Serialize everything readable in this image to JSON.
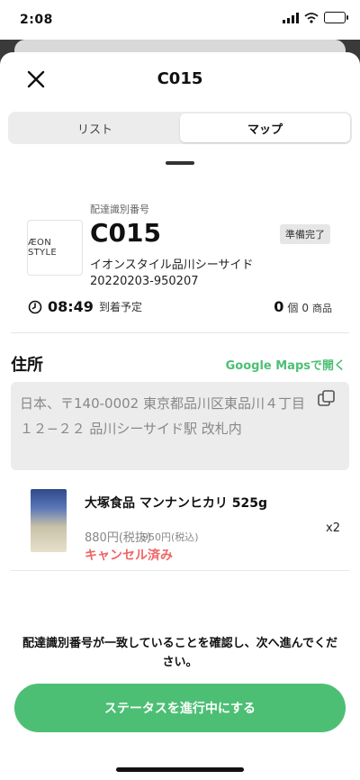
{
  "status_bar": {
    "time": "2:08"
  },
  "header": {
    "title": "C015"
  },
  "tabs": [
    {
      "label": "リスト",
      "active": false
    },
    {
      "label": "マップ",
      "active": true
    }
  ],
  "order": {
    "logo_text": "ÆON STYLE",
    "id_label": "配達識別番号",
    "code": "C015",
    "status_badge": "準備完了",
    "store_name": "イオンスタイル品川シーサイド",
    "order_number": "20220203-950207",
    "eta_time": "08:49",
    "eta_suffix": "到着予定",
    "count_value": "0",
    "count_unit": "個",
    "count_products_value": "0",
    "count_products_unit": "商品"
  },
  "address": {
    "heading": "住所",
    "google_maps_link": "Google Mapsで開く",
    "text": "日本、〒140-0002 東京都品川区東品川４丁目１２−２２ 品川シーサイド駅 改札内"
  },
  "items": [
    {
      "name": "大塚食品 マンナンヒカリ 525g",
      "price_excl": "880円(税抜)",
      "price_incl": "950円(税込)",
      "status": "キャンセル済み",
      "quantity": "x2"
    }
  ],
  "footer": {
    "confirm_text": "配達識別番号が一致していることを確認し、次へ進んでください。",
    "cta_label": "ステータスを進行中にする"
  },
  "colors": {
    "accent": "#4cbf74",
    "cancel": "#f06464"
  }
}
